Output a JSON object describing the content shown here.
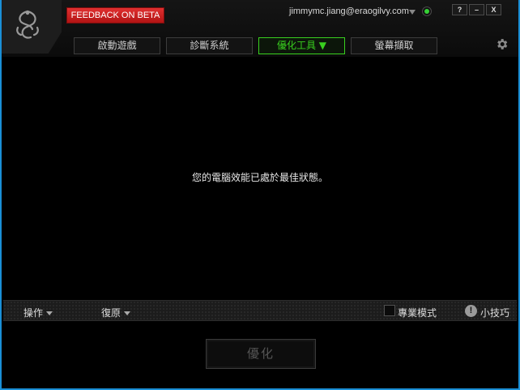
{
  "header": {
    "feedback_label": "FEEDBACK ON BETA",
    "account": "jimmymc.jiang@eraogilvy.com",
    "window_buttons": [
      "?",
      "–",
      "X"
    ]
  },
  "tabs": [
    {
      "label": "啟動遊戲",
      "active": false
    },
    {
      "label": "診斷系統",
      "active": false
    },
    {
      "label": "優化工具 ▼",
      "active": true
    },
    {
      "label": "螢幕擷取",
      "active": false
    }
  ],
  "main": {
    "message": "您的電腦效能已處於最佳狀態。"
  },
  "toolbar": {
    "operations_label": "操作",
    "restore_label": "復原",
    "expert_mode_label": "專業模式",
    "tips_label": "小技巧"
  },
  "actions": {
    "optimize_label": "優化"
  },
  "colors": {
    "accent_green": "#39d01f",
    "feedback_red": "#c81e1e",
    "window_border": "#1a8fd6",
    "status_green": "#36d236"
  },
  "icons": {
    "logo": "razer-snake-logo",
    "settings": "gear-icon",
    "status": "status-dot-icon",
    "tips": "exclamation-icon"
  }
}
